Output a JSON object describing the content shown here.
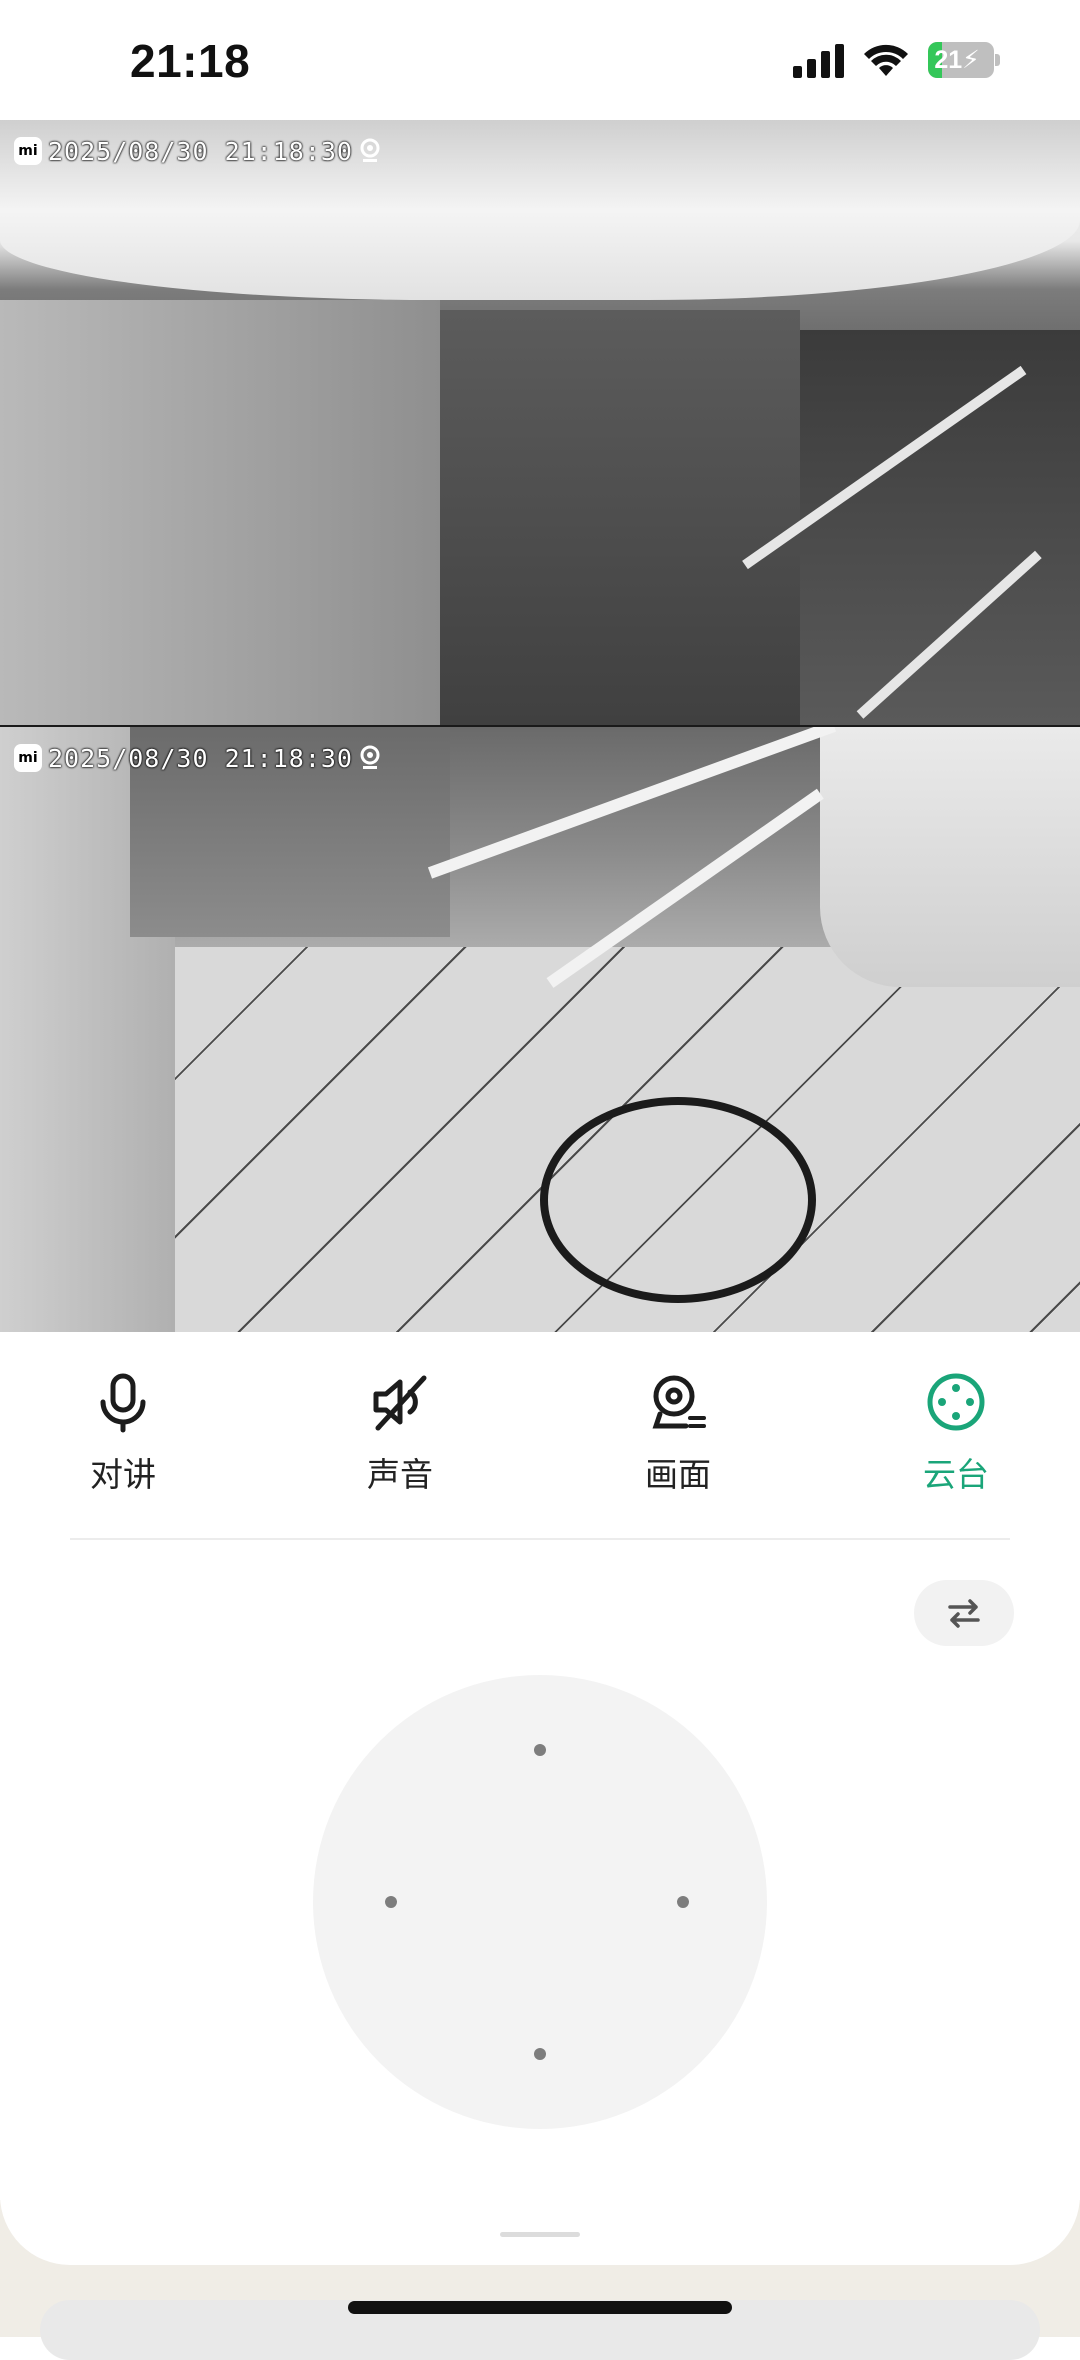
{
  "status_bar": {
    "time": "21:18",
    "battery_level": "21",
    "battery_fraction": 0.21,
    "icons": [
      "cellular-signal-icon",
      "wifi-icon",
      "battery-charging-icon"
    ]
  },
  "camera": {
    "feeds": [
      {
        "timestamp": "2025/08/30 21:18:30",
        "logo": "mi"
      },
      {
        "timestamp": "2025/08/30 21:18:30",
        "logo": "mi"
      }
    ]
  },
  "controls": {
    "items": [
      {
        "label": "对讲",
        "icon": "microphone-icon",
        "active": false
      },
      {
        "label": "声音",
        "icon": "speaker-muted-icon",
        "active": false
      },
      {
        "label": "画面",
        "icon": "camera-view-icon",
        "active": false
      },
      {
        "label": "云台",
        "icon": "ptz-icon",
        "active": true
      }
    ],
    "active_color": "#1aa579"
  },
  "ptz": {
    "swap_icon": "swap-arrows-icon",
    "directions": [
      "up",
      "left",
      "right",
      "down"
    ]
  }
}
